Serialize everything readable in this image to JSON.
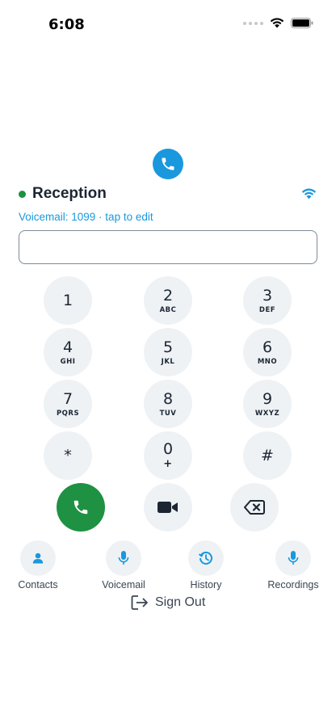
{
  "status_bar": {
    "time": "6:08"
  },
  "extension": {
    "name": "Reception",
    "voicemail_text": "Voicemail: 1099 · tap to edit"
  },
  "dial_input": {
    "value": "",
    "placeholder": ""
  },
  "keypad": [
    {
      "digit": "1",
      "letters": ""
    },
    {
      "digit": "2",
      "letters": "ABC"
    },
    {
      "digit": "3",
      "letters": "DEF"
    },
    {
      "digit": "4",
      "letters": "GHI"
    },
    {
      "digit": "5",
      "letters": "JKL"
    },
    {
      "digit": "6",
      "letters": "MNO"
    },
    {
      "digit": "7",
      "letters": "PQRS"
    },
    {
      "digit": "8",
      "letters": "TUV"
    },
    {
      "digit": "9",
      "letters": "WXYZ"
    },
    {
      "digit": "*",
      "letters": ""
    },
    {
      "digit": "0",
      "letters": "+"
    },
    {
      "digit": "#",
      "letters": ""
    }
  ],
  "actions": {
    "call_icon": "phone-icon",
    "video_icon": "video-icon",
    "delete_icon": "backspace-icon"
  },
  "nav": [
    {
      "label": "Contacts",
      "icon": "person-icon"
    },
    {
      "label": "Voicemail",
      "icon": "microphone-icon"
    },
    {
      "label": "History",
      "icon": "history-icon"
    },
    {
      "label": "Recordings",
      "icon": "microphone-icon"
    }
  ],
  "sign_out": {
    "label": "Sign Out",
    "icon": "sign-out-icon"
  },
  "colors": {
    "accent": "#1a98dd",
    "call": "#1e9142",
    "key_bg": "#eef2f5",
    "text": "#1c2633"
  }
}
